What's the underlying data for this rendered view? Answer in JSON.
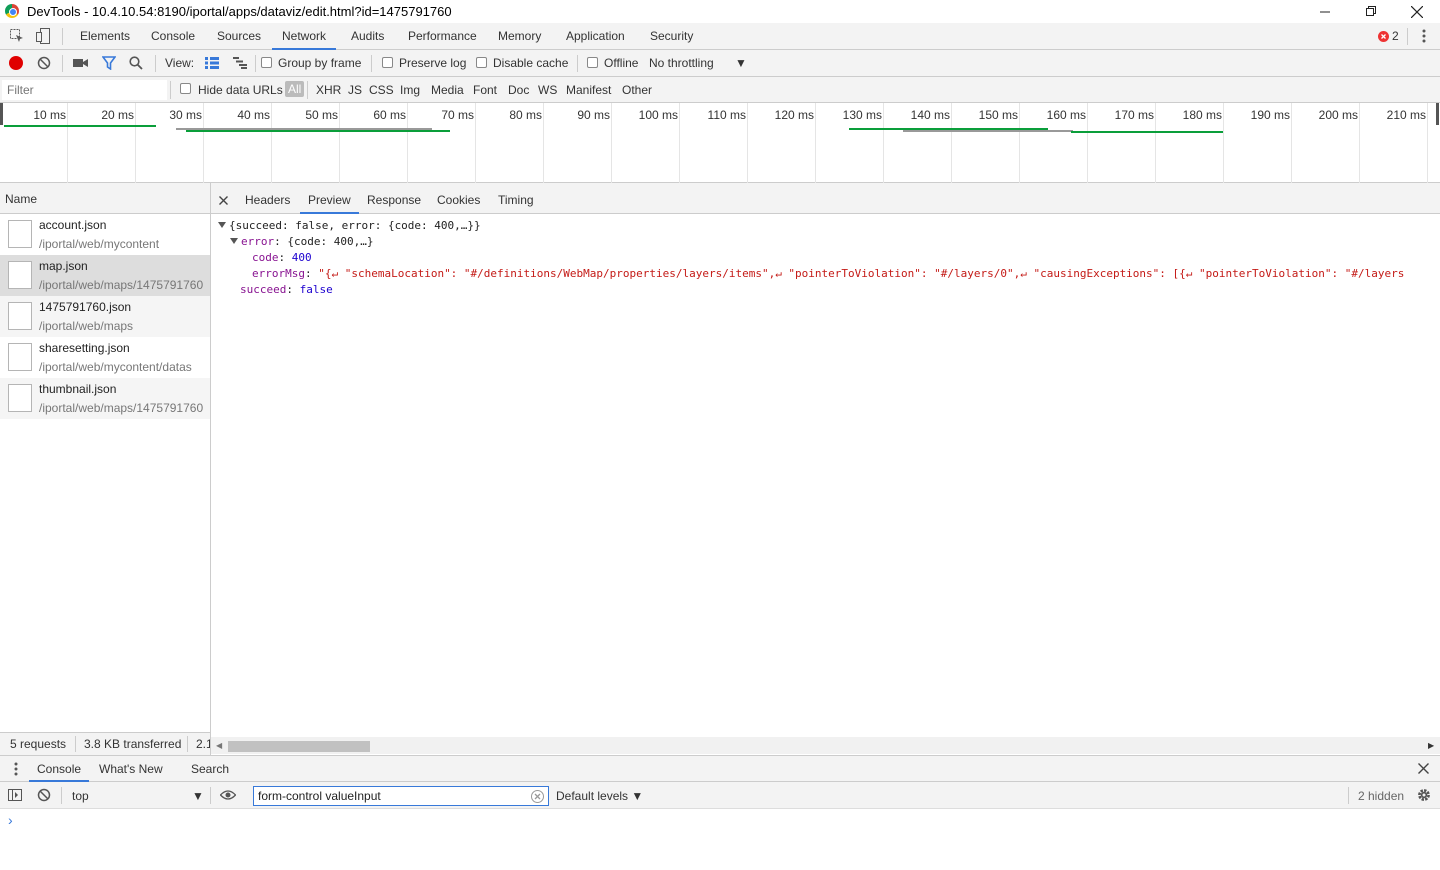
{
  "window": {
    "title": "DevTools - 10.4.10.54:8190/iportal/apps/dataviz/edit.html?id=1475791760"
  },
  "main_tabs": [
    "Elements",
    "Console",
    "Sources",
    "Network",
    "Audits",
    "Performance",
    "Memory",
    "Application",
    "Security"
  ],
  "active_main_tab": "Network",
  "error_count": "2",
  "network_toolbar": {
    "view_label": "View:",
    "group_by_frame": "Group by frame",
    "preserve_log": "Preserve log",
    "disable_cache": "Disable cache",
    "offline": "Offline",
    "throttling": "No throttling"
  },
  "filter": {
    "placeholder": "Filter",
    "hide_data_urls": "Hide data URLs",
    "types": [
      "All",
      "XHR",
      "JS",
      "CSS",
      "Img",
      "Media",
      "Font",
      "Doc",
      "WS",
      "Manifest",
      "Other"
    ]
  },
  "timeline": {
    "ticks": [
      "10 ms",
      "20 ms",
      "30 ms",
      "40 ms",
      "50 ms",
      "60 ms",
      "70 ms",
      "80 ms",
      "90 ms",
      "100 ms",
      "110 ms",
      "120 ms",
      "130 ms",
      "140 ms",
      "150 ms",
      "160 ms",
      "170 ms",
      "180 ms",
      "190 ms",
      "200 ms",
      "210 ms"
    ]
  },
  "requests": {
    "header": "Name",
    "items": [
      {
        "name": "account.json",
        "path": "/iportal/web/mycontent"
      },
      {
        "name": "map.json",
        "path": "/iportal/web/maps/1475791760"
      },
      {
        "name": "1475791760.json",
        "path": "/iportal/web/maps"
      },
      {
        "name": "sharesetting.json",
        "path": "/iportal/web/mycontent/datas"
      },
      {
        "name": "thumbnail.json",
        "path": "/iportal/web/maps/1475791760"
      }
    ],
    "selected_index": 1,
    "status": {
      "count": "5 requests",
      "transferred": "3.8 KB transferred",
      "more": "2.1"
    }
  },
  "detail_tabs": [
    "Headers",
    "Preview",
    "Response",
    "Cookies",
    "Timing"
  ],
  "active_detail_tab": "Preview",
  "preview": {
    "root": "{succeed: false, error: {code: 400,…}}",
    "error_key": "error",
    "error_summary": "{code: 400,…}",
    "code_key": "code",
    "code_value": "400",
    "errormsg_key": "errorMsg",
    "errormsg_value": "\"{↵  \"schemaLocation\": \"#/definitions/WebMap/properties/layers/items\",↵  \"pointerToViolation\": \"#/layers/0\",↵  \"causingExceptions\": [{↵    \"pointerToViolation\": \"#/layers",
    "succeed_key": "succeed",
    "succeed_value": "false"
  },
  "drawer": {
    "tabs": [
      "Console",
      "What's New",
      "Search"
    ],
    "context": "top",
    "filter_value": "form-control valueInput",
    "levels": "Default levels",
    "hidden": "2 hidden",
    "prompt": "›"
  },
  "colors": {
    "accent": "#3879d9",
    "record": "#e00000",
    "waterfall": "#0a9e3a",
    "error_text": "#c80000"
  }
}
